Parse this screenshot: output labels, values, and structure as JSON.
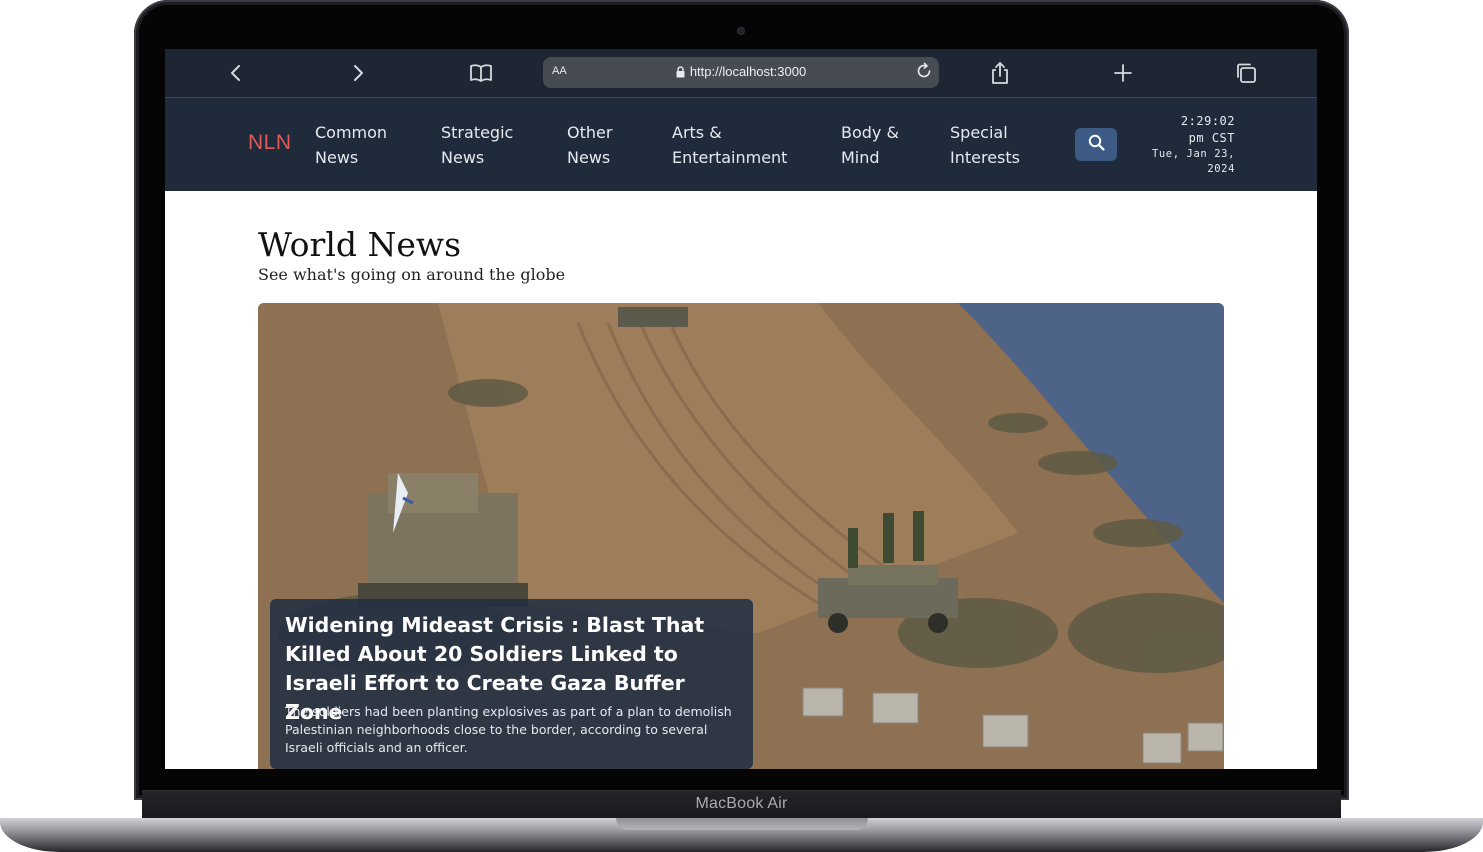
{
  "device": {
    "label": "MacBook Air"
  },
  "browser": {
    "url": "http://localhost:3000",
    "text_size_label": "AA"
  },
  "site": {
    "logo": "NLN",
    "nav": [
      {
        "label": "Common\nNews"
      },
      {
        "label": "Strategic\nNews"
      },
      {
        "label": "Other\nNews"
      },
      {
        "label": "Arts &\nEntertainment"
      },
      {
        "label": "Body &\nMind"
      },
      {
        "label": "Special\nInterests"
      }
    ],
    "clock": {
      "time": "2:29:02\npm CST",
      "date": "Tue, Jan 23,\n2024"
    }
  },
  "main": {
    "title": "World News",
    "subtitle": "See what's going on around the globe",
    "feature": {
      "headline": "Widening Mideast Crisis : Blast That Killed About 20 Soldiers Linked to Israeli Effort to Create Gaza Buffer Zone",
      "summary": "The soldiers had been planting explosives as part of a plan to demolish Palestinian neighborhoods close to the border, according to several Israeli officials and an officer."
    }
  },
  "colors": {
    "nav_background": "#1f2a3b",
    "logo_accent": "#e35a59",
    "search_button": "#3c5a83"
  }
}
